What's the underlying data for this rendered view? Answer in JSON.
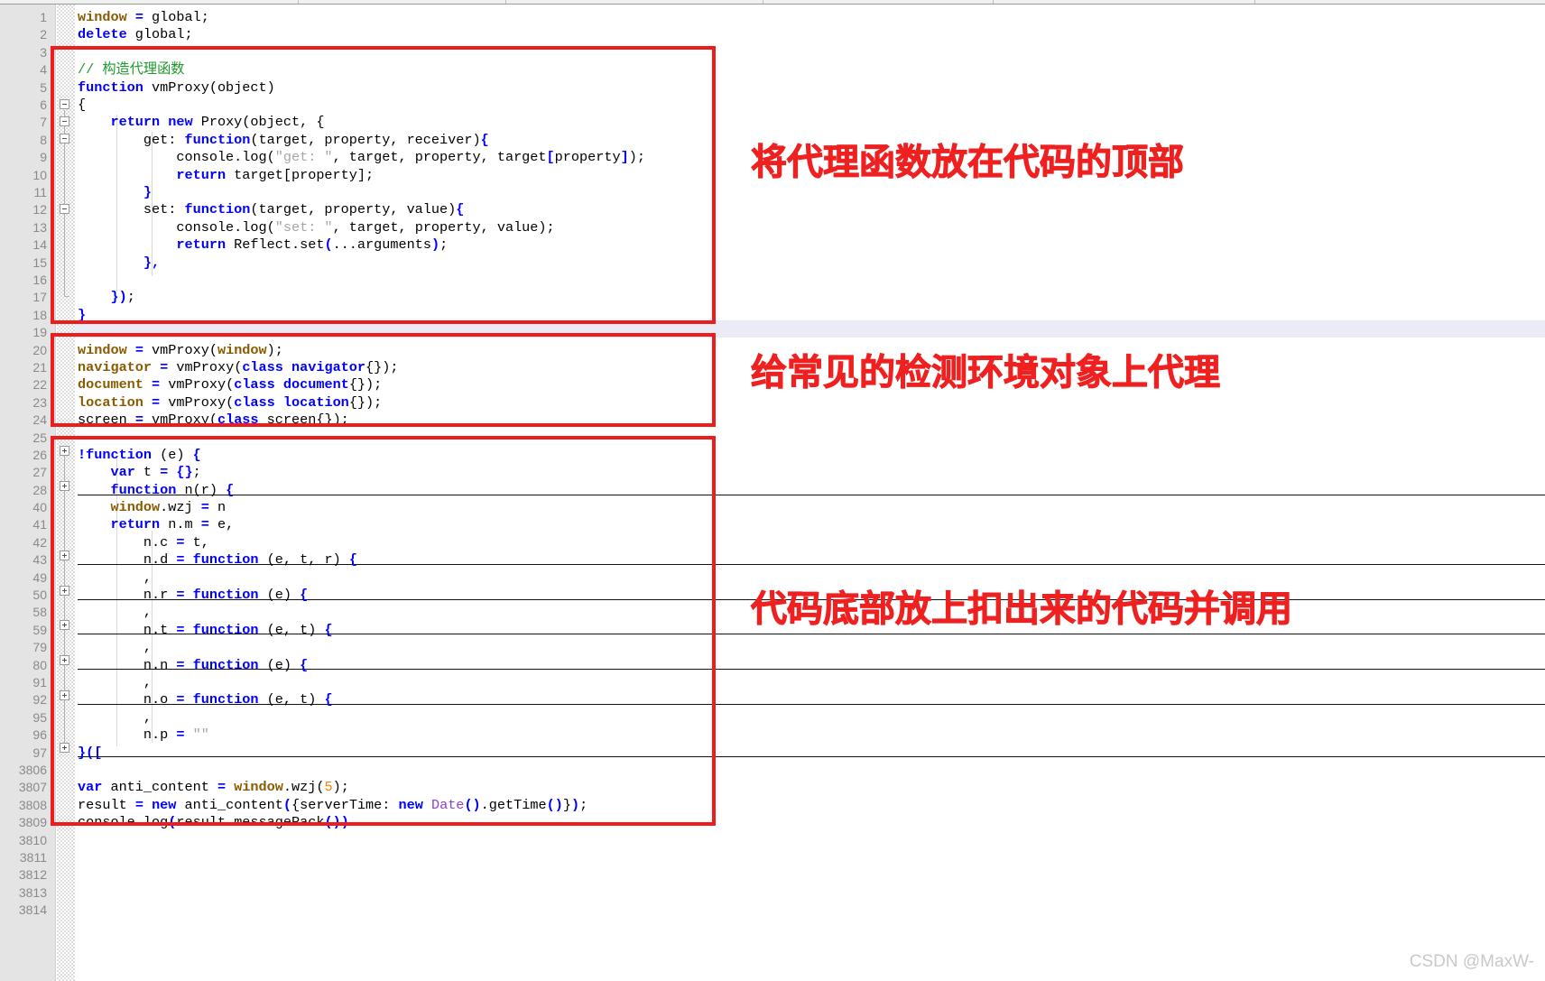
{
  "app": {
    "kind": "code-editor-screenshot",
    "watermark": "CSDN @MaxW-"
  },
  "colors": {
    "keyword": "#0000ff",
    "global_var": "#8a5a00",
    "string": "#a6a6a6",
    "comment": "#1f9a2f",
    "number": "#ff8000",
    "class_name": "#8f3fbf",
    "annotation_red": "#ef2020",
    "box_red": "#ee1c1c",
    "gutter_bg": "#e4e4e4",
    "current_line_highlight": "#ebebf8"
  },
  "gutter": {
    "line_numbers": [
      "1",
      "2",
      "3",
      "4",
      "5",
      "6",
      "7",
      "8",
      "9",
      "10",
      "11",
      "12",
      "13",
      "14",
      "15",
      "16",
      "17",
      "18",
      "19",
      "20",
      "21",
      "22",
      "23",
      "24",
      "25",
      "26",
      "27",
      "28",
      "40",
      "41",
      "42",
      "43",
      "49",
      "50",
      "58",
      "59",
      "79",
      "80",
      "91",
      "92",
      "95",
      "96",
      "97",
      "3806",
      "3807",
      "3808",
      "3809",
      "3810",
      "3811",
      "3812",
      "3813",
      "3814"
    ]
  },
  "code_lines": [
    {
      "n": "1",
      "text": "window = global;"
    },
    {
      "n": "2",
      "text": "delete global;"
    },
    {
      "n": "3",
      "text": ""
    },
    {
      "n": "4",
      "text": "// 构造代理函数"
    },
    {
      "n": "5",
      "text": "function vmProxy(object)"
    },
    {
      "n": "6",
      "text": "{"
    },
    {
      "n": "7",
      "text": "    return new Proxy(object, {"
    },
    {
      "n": "8",
      "text": "        get: function(target, property, receiver){"
    },
    {
      "n": "9",
      "text": "            console.log(\"get: \", target, property, target[property]);"
    },
    {
      "n": "10",
      "text": "            return target[property];"
    },
    {
      "n": "11",
      "text": "        }"
    },
    {
      "n": "12",
      "text": "        set: function(target, property, value){"
    },
    {
      "n": "13",
      "text": "            console.log(\"set: \", target, property, value);"
    },
    {
      "n": "14",
      "text": "            return Reflect.set(...arguments);"
    },
    {
      "n": "15",
      "text": "        },"
    },
    {
      "n": "16",
      "text": ""
    },
    {
      "n": "17",
      "text": "    });"
    },
    {
      "n": "18",
      "text": "}"
    },
    {
      "n": "19",
      "text": ""
    },
    {
      "n": "20",
      "text": "window = vmProxy(window);"
    },
    {
      "n": "21",
      "text": "navigator = vmProxy(class navigator{});"
    },
    {
      "n": "22",
      "text": "document = vmProxy(class document{});"
    },
    {
      "n": "23",
      "text": "location = vmProxy(class location{});"
    },
    {
      "n": "24",
      "text": "screen = vmProxy(class screen{});"
    },
    {
      "n": "25",
      "text": ""
    },
    {
      "n": "26",
      "text": "!function (e) {"
    },
    {
      "n": "27",
      "text": "    var t = {};"
    },
    {
      "n": "28",
      "text": "    function n(r) {"
    },
    {
      "n": "40",
      "text": "    window.wzj = n"
    },
    {
      "n": "41",
      "text": "    return n.m = e,"
    },
    {
      "n": "42",
      "text": "        n.c = t,"
    },
    {
      "n": "43",
      "text": "        n.d = function (e, t, r) {"
    },
    {
      "n": "49",
      "text": "        ,"
    },
    {
      "n": "50",
      "text": "        n.r = function (e) {"
    },
    {
      "n": "58",
      "text": "        ,"
    },
    {
      "n": "59",
      "text": "        n.t = function (e, t) {"
    },
    {
      "n": "79",
      "text": "        ,"
    },
    {
      "n": "80",
      "text": "        n.n = function (e) {"
    },
    {
      "n": "91",
      "text": "        ,"
    },
    {
      "n": "92",
      "text": "        n.o = function (e, t) {"
    },
    {
      "n": "95",
      "text": "        ,"
    },
    {
      "n": "96",
      "text": "        n.p = \"\""
    },
    {
      "n": "97",
      "text": "}(["
    },
    {
      "n": "3806",
      "text": ""
    },
    {
      "n": "3807",
      "text": "var anti_content = window.wzj(5);"
    },
    {
      "n": "3808",
      "text": "result = new anti_content({serverTime: new Date().getTime()});"
    },
    {
      "n": "3809",
      "text": "console.log(result.messagePack())"
    },
    {
      "n": "3810",
      "text": ""
    },
    {
      "n": "3811",
      "text": ""
    },
    {
      "n": "3812",
      "text": ""
    },
    {
      "n": "3813",
      "text": ""
    },
    {
      "n": "3814",
      "text": ""
    }
  ],
  "annotations": [
    {
      "id": "anno-1",
      "text": "将代理函数放在代码的顶部"
    },
    {
      "id": "anno-2",
      "text": "给常见的检测环境对象上代理"
    },
    {
      "id": "anno-3",
      "text": "代码底部放上扣出来的代码并调用"
    }
  ],
  "red_boxes": [
    {
      "id": "redbox-proxy-definition",
      "covers_lines": "3-18"
    },
    {
      "id": "redbox-env-proxying",
      "covers_lines": "20-24"
    },
    {
      "id": "redbox-extracted-code",
      "covers_lines": "26-3809"
    }
  ]
}
